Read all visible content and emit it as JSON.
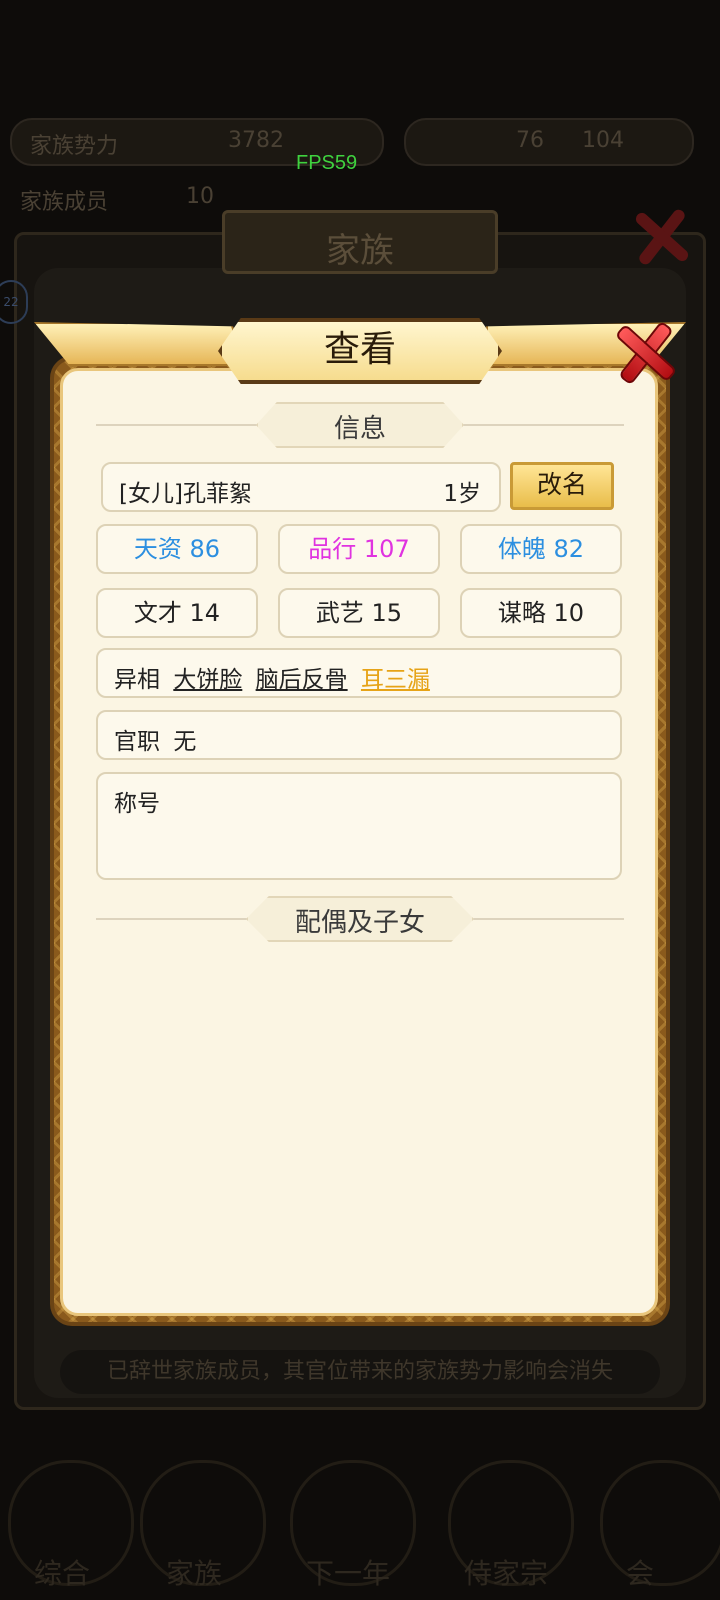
{
  "overlay": {
    "fps": "FPS59"
  },
  "background": {
    "family_power_label": "家族势力",
    "family_power_value": "3782",
    "resource_value": "76",
    "resource_value2": "104",
    "member_label": "家族成员",
    "member_value": "10",
    "bg_title": "家族",
    "badge_count": "22",
    "notice": "已辞世家族成员，其官位带来的家族势力影响会消失",
    "nav": [
      "综合",
      "家族",
      "下一年",
      "侍家宗",
      "会"
    ]
  },
  "dialog": {
    "title": "查看",
    "info_section": "信息",
    "name": "[女儿]孔菲絮",
    "age": "1岁",
    "rename_button": "改名",
    "stats": [
      {
        "label": "天资 86",
        "color": "#2c8fe0"
      },
      {
        "label": "品行 107",
        "color": "#e033e0"
      },
      {
        "label": "体魄 82",
        "color": "#2c8fe0"
      },
      {
        "label": "文才 14",
        "color": "#222222"
      },
      {
        "label": "武艺 15",
        "color": "#222222"
      },
      {
        "label": "谋略 10",
        "color": "#222222"
      }
    ],
    "traits_label": "异相",
    "traits": [
      "大饼脸",
      "脑后反骨",
      "耳三漏"
    ],
    "traits_gold_index": 2,
    "office_label": "官职",
    "office_value": "无",
    "title_label": "称号",
    "spouse_section": "配偶及子女"
  }
}
